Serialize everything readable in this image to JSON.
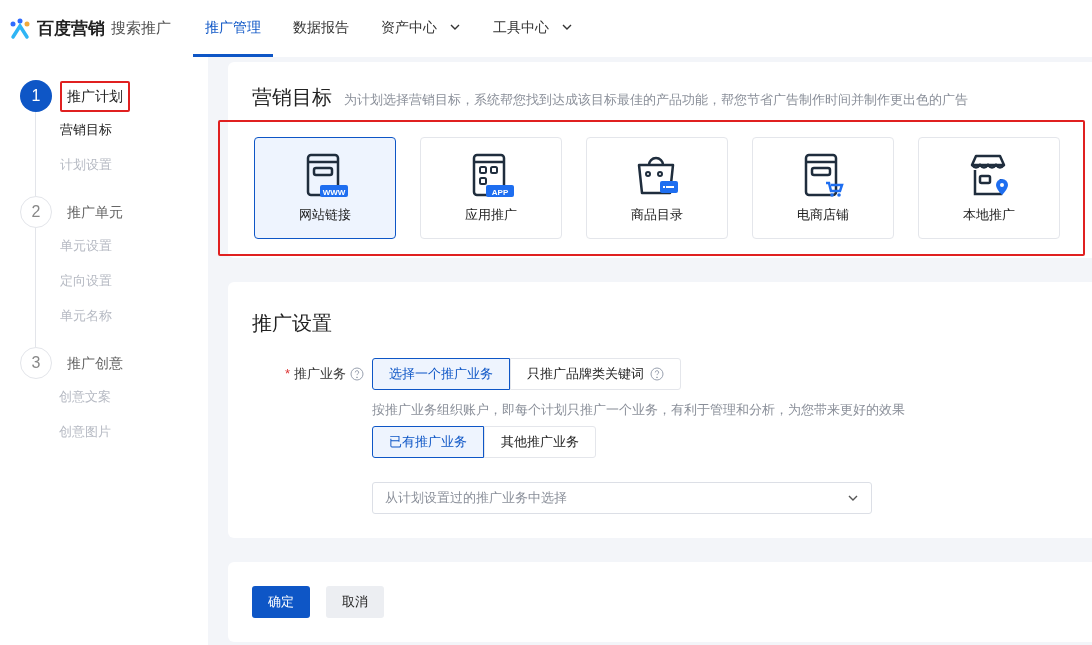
{
  "brand": {
    "name": "百度营销",
    "product": "搜索推广"
  },
  "nav": [
    {
      "label": "推广管理",
      "selected": true,
      "dropdown": false
    },
    {
      "label": "数据报告",
      "selected": false,
      "dropdown": false
    },
    {
      "label": "资产中心",
      "selected": false,
      "dropdown": true
    },
    {
      "label": "工具中心",
      "selected": false,
      "dropdown": true
    }
  ],
  "steps": [
    {
      "number": "1",
      "title": "推广计划",
      "active": true,
      "highlighted": true,
      "children": [
        {
          "label": "营销目标",
          "active": true
        },
        {
          "label": "计划设置",
          "active": false
        }
      ]
    },
    {
      "number": "2",
      "title": "推广单元",
      "active": false,
      "highlighted": false,
      "children": [
        {
          "label": "单元设置",
          "active": false
        },
        {
          "label": "定向设置",
          "active": false
        },
        {
          "label": "单元名称",
          "active": false
        }
      ]
    },
    {
      "number": "3",
      "title": "推广创意",
      "active": false,
      "highlighted": false,
      "children": [
        {
          "label": "创意文案",
          "active": false
        },
        {
          "label": "创意图片",
          "active": false
        }
      ]
    }
  ],
  "marketing_goal": {
    "title": "营销目标",
    "description": "为计划选择营销目标，系统帮您找到达成该目标最佳的产品功能，帮您节省广告制作时间并制作更出色的广告",
    "highlighted": true,
    "options": [
      {
        "kind": "website",
        "badge": "WWW",
        "label": "网站链接",
        "selected": true
      },
      {
        "kind": "app",
        "badge": "APP",
        "label": "应用推广",
        "selected": false
      },
      {
        "kind": "catalog",
        "label": "商品目录",
        "selected": false
      },
      {
        "kind": "shop",
        "label": "电商店铺",
        "selected": false
      },
      {
        "kind": "local",
        "label": "本地推广",
        "selected": false
      }
    ]
  },
  "settings": {
    "title": "推广设置",
    "field_label": "推广业务",
    "required_mark": "*",
    "mode_options": [
      {
        "label": "选择一个推广业务",
        "selected": true,
        "help": false
      },
      {
        "label": "只推广品牌类关键词",
        "selected": false,
        "help": true
      }
    ],
    "hint": "按推广业务组织账户，即每个计划只推广一个业务，有利于管理和分析，为您带来更好的效果",
    "source_options": [
      {
        "label": "已有推广业务",
        "selected": true
      },
      {
        "label": "其他推广业务",
        "selected": false
      }
    ],
    "select": {
      "placeholder": "从计划设置过的推广业务中选择"
    }
  },
  "actions": [
    {
      "label": "确定",
      "kind": "primary"
    },
    {
      "label": "取消",
      "kind": "secondary"
    }
  ]
}
